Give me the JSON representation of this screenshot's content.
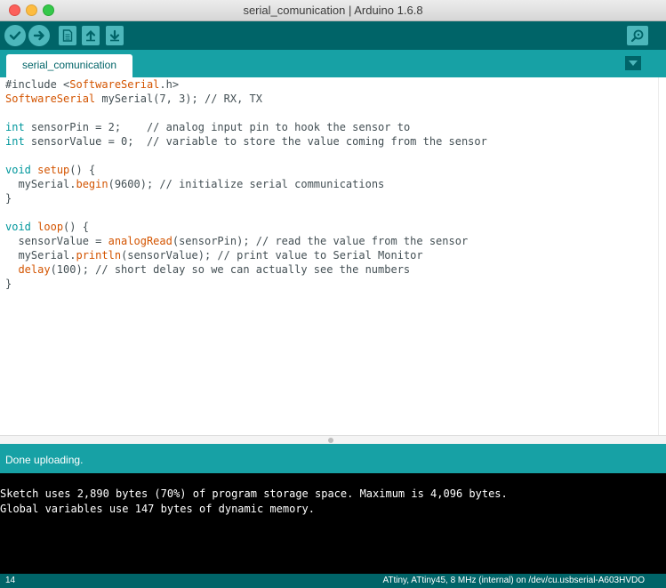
{
  "window": {
    "title": "serial_comunication | Arduino 1.6.8"
  },
  "toolbar": {
    "buttons": [
      {
        "name": "verify",
        "icon": "check-icon"
      },
      {
        "name": "upload",
        "icon": "arrow-right-icon"
      },
      {
        "name": "new",
        "icon": "new-file-icon"
      },
      {
        "name": "open",
        "icon": "arrow-up-icon"
      },
      {
        "name": "save",
        "icon": "arrow-down-icon"
      }
    ],
    "serial_monitor_icon": "magnifier-icon"
  },
  "tabs": [
    {
      "label": "serial_comunication",
      "active": true
    }
  ],
  "editor": {
    "lines": [
      [
        {
          "t": "#include <"
        },
        {
          "t": "SoftwareSerial",
          "c": "fn"
        },
        {
          "t": ".h>"
        }
      ],
      [
        {
          "t": "SoftwareSerial",
          "c": "fn"
        },
        {
          "t": " mySerial(7, 3); // RX, TX"
        }
      ],
      [],
      [
        {
          "t": "int",
          "c": "kw"
        },
        {
          "t": " sensorPin = 2;    // analog input pin to hook the sensor to"
        }
      ],
      [
        {
          "t": "int",
          "c": "kw"
        },
        {
          "t": " sensorValue = 0;  // variable to store the value coming from the sensor"
        }
      ],
      [],
      [
        {
          "t": "void",
          "c": "kw"
        },
        {
          "t": " "
        },
        {
          "t": "setup",
          "c": "fn"
        },
        {
          "t": "() {"
        }
      ],
      [
        {
          "t": "  mySerial."
        },
        {
          "t": "begin",
          "c": "fn"
        },
        {
          "t": "(9600); // initialize serial communications"
        }
      ],
      [
        {
          "t": "}"
        }
      ],
      [],
      [
        {
          "t": "void",
          "c": "kw"
        },
        {
          "t": " "
        },
        {
          "t": "loop",
          "c": "fn"
        },
        {
          "t": "() {"
        }
      ],
      [
        {
          "t": "  sensorValue = "
        },
        {
          "t": "analogRead",
          "c": "fn"
        },
        {
          "t": "(sensorPin); // read the value from the sensor"
        }
      ],
      [
        {
          "t": "  mySerial."
        },
        {
          "t": "println",
          "c": "fn"
        },
        {
          "t": "(sensorValue); // print value to Serial Monitor"
        }
      ],
      [
        {
          "t": "  "
        },
        {
          "t": "delay",
          "c": "fn"
        },
        {
          "t": "(100); // short delay so we can actually see the numbers"
        }
      ],
      [
        {
          "t": "}"
        }
      ]
    ]
  },
  "status": {
    "message": "Done uploading."
  },
  "console": {
    "lines": [
      "Sketch uses 2,890 bytes (70%) of program storage space. Maximum is 4,096 bytes.",
      "Global variables use 147 bytes of dynamic memory."
    ]
  },
  "footer": {
    "line_number": "14",
    "board_info": "ATtiny, ATtiny45, 8 MHz (internal) on /dev/cu.usbserial-A603HVDO"
  },
  "colors": {
    "toolbar": "#006468",
    "tabbar": "#17a1a5",
    "button": "#4db7bb",
    "keyword": "#00979c",
    "function": "#d35400"
  }
}
